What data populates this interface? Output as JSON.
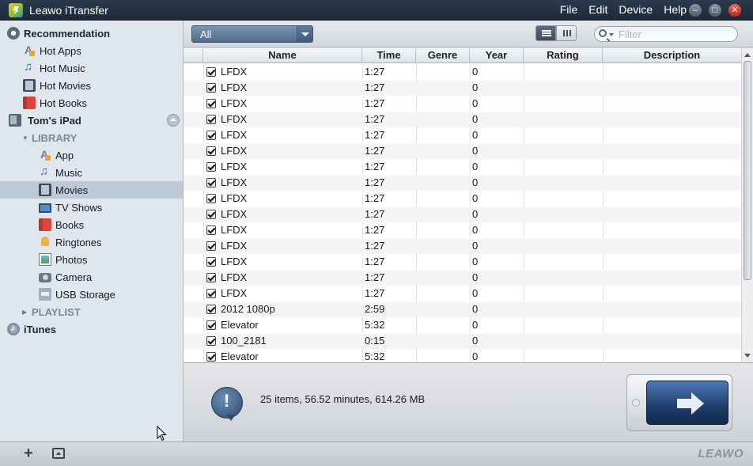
{
  "app": {
    "title": "Leawo iTransfer"
  },
  "menu": [
    "File",
    "Edit",
    "Device",
    "Help"
  ],
  "sidebar": {
    "recommendation": "Recommendation",
    "hot_items": [
      "Hot Apps",
      "Hot Music",
      "Hot Movies",
      "Hot Books"
    ],
    "device": "Tom's iPad",
    "library_label": "LIBRARY",
    "library_items": [
      "App",
      "Music",
      "Movies",
      "TV Shows",
      "Books",
      "Ringtones",
      "Photos",
      "Camera",
      "USB Storage"
    ],
    "selected": "Movies",
    "playlist_label": "PLAYLIST",
    "itunes": "iTunes"
  },
  "toolbar": {
    "category_value": "All",
    "filter_placeholder": "Filter",
    "view_mode": "list"
  },
  "table": {
    "columns": [
      "Name",
      "Time",
      "Genre",
      "Year",
      "Rating",
      "Description"
    ],
    "rows": [
      {
        "checked": true,
        "name": "LFDX",
        "time": "1:27",
        "genre": "",
        "year": "0",
        "rating": "",
        "description": ""
      },
      {
        "checked": true,
        "name": "LFDX",
        "time": "1:27",
        "genre": "",
        "year": "0",
        "rating": "",
        "description": ""
      },
      {
        "checked": true,
        "name": "LFDX",
        "time": "1:27",
        "genre": "",
        "year": "0",
        "rating": "",
        "description": ""
      },
      {
        "checked": true,
        "name": "LFDX",
        "time": "1:27",
        "genre": "",
        "year": "0",
        "rating": "",
        "description": ""
      },
      {
        "checked": true,
        "name": "LFDX",
        "time": "1:27",
        "genre": "",
        "year": "0",
        "rating": "",
        "description": ""
      },
      {
        "checked": true,
        "name": "LFDX",
        "time": "1:27",
        "genre": "",
        "year": "0",
        "rating": "",
        "description": ""
      },
      {
        "checked": true,
        "name": "LFDX",
        "time": "1:27",
        "genre": "",
        "year": "0",
        "rating": "",
        "description": ""
      },
      {
        "checked": true,
        "name": "LFDX",
        "time": "1:27",
        "genre": "",
        "year": "0",
        "rating": "",
        "description": ""
      },
      {
        "checked": true,
        "name": "LFDX",
        "time": "1:27",
        "genre": "",
        "year": "0",
        "rating": "",
        "description": ""
      },
      {
        "checked": true,
        "name": "LFDX",
        "time": "1:27",
        "genre": "",
        "year": "0",
        "rating": "",
        "description": ""
      },
      {
        "checked": true,
        "name": "LFDX",
        "time": "1:27",
        "genre": "",
        "year": "0",
        "rating": "",
        "description": ""
      },
      {
        "checked": true,
        "name": "LFDX",
        "time": "1:27",
        "genre": "",
        "year": "0",
        "rating": "",
        "description": ""
      },
      {
        "checked": true,
        "name": "LFDX",
        "time": "1:27",
        "genre": "",
        "year": "0",
        "rating": "",
        "description": ""
      },
      {
        "checked": true,
        "name": "LFDX",
        "time": "1:27",
        "genre": "",
        "year": "0",
        "rating": "",
        "description": ""
      },
      {
        "checked": true,
        "name": "LFDX",
        "time": "1:27",
        "genre": "",
        "year": "0",
        "rating": "",
        "description": ""
      },
      {
        "checked": true,
        "name": "2012 1080p",
        "time": "2:59",
        "genre": "",
        "year": "0",
        "rating": "",
        "description": ""
      },
      {
        "checked": true,
        "name": "Elevator",
        "time": "5:32",
        "genre": "",
        "year": "0",
        "rating": "",
        "description": ""
      },
      {
        "checked": true,
        "name": "100_2181",
        "time": "0:15",
        "genre": "",
        "year": "0",
        "rating": "",
        "description": ""
      },
      {
        "checked": true,
        "name": "Elevator",
        "time": "5:32",
        "genre": "",
        "year": "0",
        "rating": "",
        "description": ""
      }
    ]
  },
  "status": {
    "summary": "25 items, 56.52 minutes, 614.26 MB"
  },
  "footer": {
    "brand": "LEAWO"
  },
  "colors": {
    "titlebar": "#1d2938",
    "selection": "#bccad8",
    "transfer_button": "#1e3d6a"
  }
}
